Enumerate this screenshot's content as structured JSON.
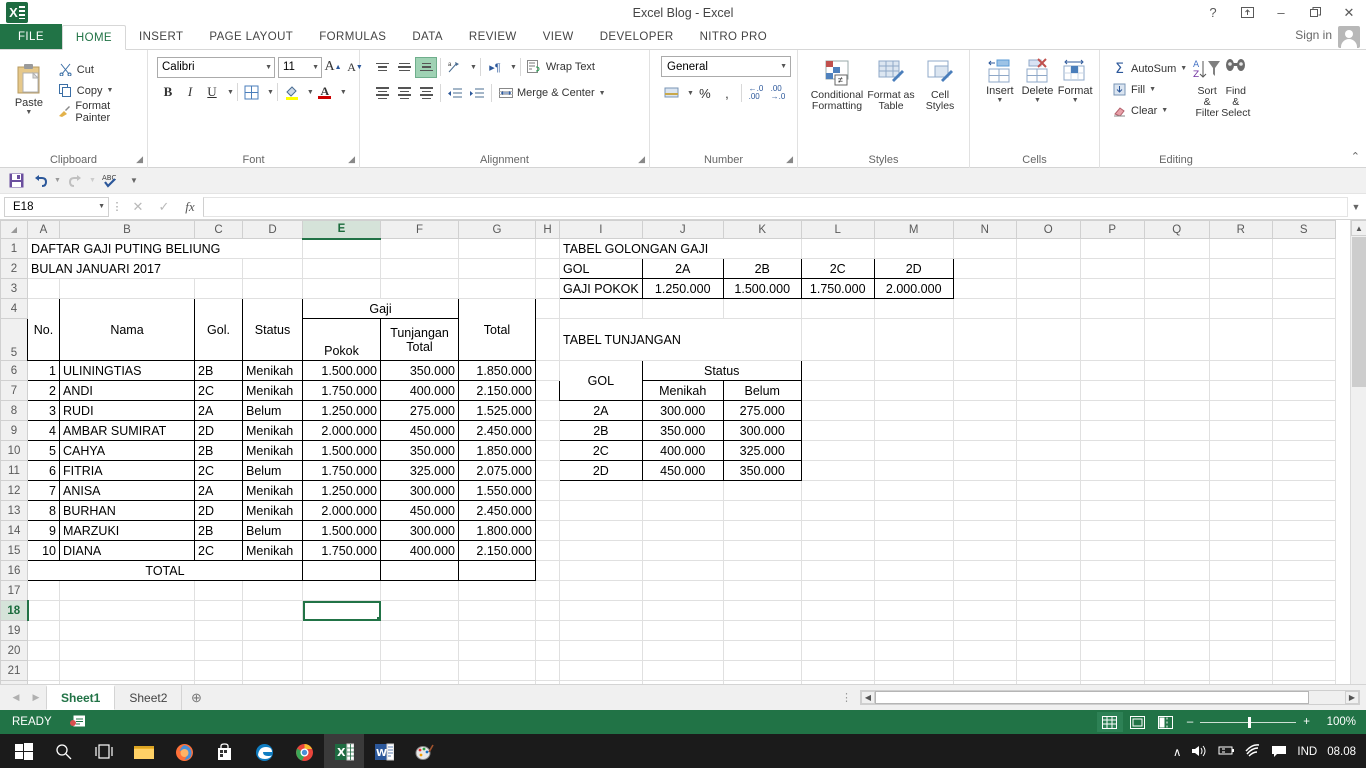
{
  "window": {
    "title": "Excel Blog - Excel",
    "help_icon": "?",
    "ribbon_display_icon": "ribbon-options",
    "minimize_icon": "–",
    "restore_icon": "❐",
    "close_icon": "✕",
    "signin_label": "Sign in",
    "app_logo": "excel-logo"
  },
  "ribbon_tabs": [
    {
      "label": "FILE",
      "active": false,
      "kind": "file"
    },
    {
      "label": "HOME",
      "active": true,
      "kind": "normal"
    },
    {
      "label": "INSERT",
      "active": false,
      "kind": "normal"
    },
    {
      "label": "PAGE LAYOUT",
      "active": false,
      "kind": "normal"
    },
    {
      "label": "FORMULAS",
      "active": false,
      "kind": "normal"
    },
    {
      "label": "DATA",
      "active": false,
      "kind": "normal"
    },
    {
      "label": "REVIEW",
      "active": false,
      "kind": "normal"
    },
    {
      "label": "VIEW",
      "active": false,
      "kind": "normal"
    },
    {
      "label": "DEVELOPER",
      "active": false,
      "kind": "normal"
    },
    {
      "label": "NITRO PRO",
      "active": false,
      "kind": "normal"
    }
  ],
  "ribbon": {
    "clipboard": {
      "group_label": "Clipboard",
      "paste_label": "Paste",
      "cut_label": "Cut",
      "copy_label": "Copy",
      "format_painter_label": "Format Painter"
    },
    "font": {
      "group_label": "Font",
      "font_name": "Calibri",
      "font_size": "11",
      "grow_font": "A",
      "shrink_font": "A",
      "bold": "B",
      "italic": "I",
      "underline": "U"
    },
    "alignment": {
      "group_label": "Alignment",
      "wrap_text_label": "Wrap Text",
      "merge_center_label": "Merge & Center"
    },
    "number": {
      "group_label": "Number",
      "format_value": "General",
      "percent": "%",
      "comma": ","
    },
    "styles": {
      "group_label": "Styles",
      "conditional_formatting_label": "Conditional Formatting",
      "format_as_table_label": "Format as Table",
      "cell_styles_label": "Cell Styles"
    },
    "cells": {
      "group_label": "Cells",
      "insert_label": "Insert",
      "delete_label": "Delete",
      "format_label": "Format"
    },
    "editing": {
      "group_label": "Editing",
      "autosum_label": "AutoSum",
      "fill_label": "Fill",
      "clear_label": "Clear",
      "sort_filter_label": "Sort & Filter",
      "find_select_label": "Find & Select"
    }
  },
  "formula_bar": {
    "name_box": "E18",
    "formula_value": "",
    "cancel_icon": "✕",
    "enter_icon": "✓",
    "function_icon": "fx"
  },
  "grid": {
    "columns": [
      "A",
      "B",
      "C",
      "D",
      "E",
      "F",
      "G",
      "H",
      "I",
      "J",
      "K",
      "L",
      "M",
      "N",
      "O",
      "P",
      "Q",
      "R",
      "S"
    ],
    "selected_cell": "E18",
    "selected_column": "E",
    "selected_row": "18",
    "rows": [
      "1",
      "2",
      "3",
      "4",
      "5",
      "6",
      "7",
      "8",
      "9",
      "10",
      "11",
      "12",
      "13",
      "14",
      "15",
      "16",
      "17",
      "18",
      "19",
      "20",
      "21",
      "22"
    ]
  },
  "sheet_content": {
    "title_line1": "DAFTAR GAJI PUTING BELIUNG",
    "title_line2": "BULAN JANUARI 2017",
    "main_table": {
      "header_group": "Gaji",
      "headers": [
        "No.",
        "Nama",
        "Gol.",
        "Status",
        "Pokok",
        "Tunjangan Total",
        "Total"
      ],
      "header_pokok": "Pokok",
      "header_tunjangan_line1": "Tunjangan",
      "header_tunjangan_line2": "Total",
      "header_total": "Total",
      "rows": [
        {
          "no": "1",
          "nama": "ULININGTIAS",
          "gol": "2B",
          "status": "Menikah",
          "pokok": "1.500.000",
          "tunjangan": "350.000",
          "total": "1.850.000"
        },
        {
          "no": "2",
          "nama": "ANDI",
          "gol": "2C",
          "status": "Menikah",
          "pokok": "1.750.000",
          "tunjangan": "400.000",
          "total": "2.150.000"
        },
        {
          "no": "3",
          "nama": "RUDI",
          "gol": "2A",
          "status": "Belum",
          "pokok": "1.250.000",
          "tunjangan": "275.000",
          "total": "1.525.000"
        },
        {
          "no": "4",
          "nama": "AMBAR SUMIRAT",
          "gol": "2D",
          "status": "Menikah",
          "pokok": "2.000.000",
          "tunjangan": "450.000",
          "total": "2.450.000"
        },
        {
          "no": "5",
          "nama": "CAHYA",
          "gol": "2B",
          "status": "Menikah",
          "pokok": "1.500.000",
          "tunjangan": "350.000",
          "total": "1.850.000"
        },
        {
          "no": "6",
          "nama": "FITRIA",
          "gol": "2C",
          "status": "Belum",
          "pokok": "1.750.000",
          "tunjangan": "325.000",
          "total": "2.075.000"
        },
        {
          "no": "7",
          "nama": "ANISA",
          "gol": "2A",
          "status": "Menikah",
          "pokok": "1.250.000",
          "tunjangan": "300.000",
          "total": "1.550.000"
        },
        {
          "no": "8",
          "nama": "BURHAN",
          "gol": "2D",
          "status": "Menikah",
          "pokok": "2.000.000",
          "tunjangan": "450.000",
          "total": "2.450.000"
        },
        {
          "no": "9",
          "nama": "MARZUKI",
          "gol": "2B",
          "status": "Belum",
          "pokok": "1.500.000",
          "tunjangan": "300.000",
          "total": "1.800.000"
        },
        {
          "no": "10",
          "nama": "DIANA",
          "gol": "2C",
          "status": "Menikah",
          "pokok": "1.750.000",
          "tunjangan": "400.000",
          "total": "2.150.000"
        }
      ],
      "total_label": "TOTAL",
      "total_pokok": "",
      "total_tunjangan": "",
      "total_total": ""
    },
    "tabel_golongan": {
      "title": "TABEL GOLONGAN GAJI",
      "row_label_gol": "GOL",
      "row_label_gaji": "GAJI POKOK",
      "gol": [
        "2A",
        "2B",
        "2C",
        "2D"
      ],
      "gaji_pokok": [
        "1.250.000",
        "1.500.000",
        "1.750.000",
        "2.000.000"
      ]
    },
    "tabel_tunjangan": {
      "title": "TABEL TUNJANGAN",
      "header_gol": "GOL",
      "header_status": "Status",
      "header_menikah": "Menikah",
      "header_belum": "Belum",
      "rows": [
        {
          "gol": "2A",
          "menikah": "300.000",
          "belum": "275.000"
        },
        {
          "gol": "2B",
          "menikah": "350.000",
          "belum": "300.000"
        },
        {
          "gol": "2C",
          "menikah": "400.000",
          "belum": "325.000"
        },
        {
          "gol": "2D",
          "menikah": "450.000",
          "belum": "350.000"
        }
      ]
    }
  },
  "sheet_tabs": {
    "tabs": [
      {
        "label": "Sheet1",
        "active": true
      },
      {
        "label": "Sheet2",
        "active": false
      }
    ],
    "add_sheet_icon": "⊕",
    "prev_icon": "◀",
    "next_icon": "▶"
  },
  "status_bar": {
    "status_text": "READY",
    "macro_icon": "record-macro-icon",
    "view_normal_icon": "normal-view-icon",
    "view_layout_icon": "page-layout-icon",
    "view_break_icon": "page-break-icon",
    "zoom_out": "–",
    "zoom_in": "+",
    "zoom_level": "100%"
  },
  "taskbar": {
    "items": [
      {
        "name": "start-button",
        "glyph": "windows"
      },
      {
        "name": "search-icon",
        "glyph": "search"
      },
      {
        "name": "task-view-icon",
        "glyph": "taskview"
      },
      {
        "name": "file-explorer-icon",
        "glyph": "folder"
      },
      {
        "name": "firefox-icon",
        "glyph": "firefox"
      },
      {
        "name": "store-icon",
        "glyph": "store"
      },
      {
        "name": "edge-icon",
        "glyph": "edge"
      },
      {
        "name": "chrome-icon",
        "glyph": "chrome"
      },
      {
        "name": "excel-icon",
        "glyph": "excel"
      },
      {
        "name": "word-icon",
        "glyph": "word"
      },
      {
        "name": "paint-icon",
        "glyph": "paint"
      }
    ],
    "tray": {
      "show_hidden_icon": "∧",
      "volume_icon": "🔊",
      "battery_icon": "battery",
      "network_icon": "wifi",
      "action_center_icon": "notification",
      "language": "IND",
      "clock": "08.08"
    }
  },
  "colors": {
    "excel_green": "#217346",
    "status_bar": "#217346",
    "selection": "#217346"
  }
}
